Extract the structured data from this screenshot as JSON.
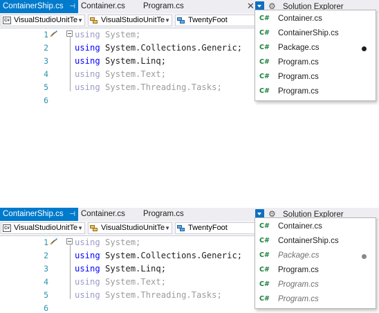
{
  "colors": {
    "accent": "#007acc",
    "keyword": "#0000ff",
    "line_number": "#2b91af",
    "csharp_icon": "#1a7f38"
  },
  "panels": [
    {
      "tabs": [
        {
          "label": "ContainerShip.cs",
          "pin": "⊣",
          "active": true
        },
        {
          "label": "Container.cs",
          "active": false
        },
        {
          "label": "Program.cs",
          "active": false
        }
      ],
      "solution_explorer_title": "Solution Explorer",
      "nav": {
        "project": "VisualStudioUnitTe",
        "namespace": "VisualStudioUnitTe",
        "member": "TwentyFoot"
      },
      "code_lines": [
        {
          "n": "1",
          "kw": "using",
          "rest": " System;",
          "dim": true
        },
        {
          "n": "2",
          "kw": "using",
          "rest": " System.Collections.Generic;",
          "dim": false
        },
        {
          "n": "3",
          "kw": "using",
          "rest": " System.Linq;",
          "dim": false
        },
        {
          "n": "4",
          "kw": "using",
          "rest": " System.Text;",
          "dim": true
        },
        {
          "n": "5",
          "kw": "using",
          "rest": " System.Threading.Tasks;",
          "dim": true
        },
        {
          "n": "6",
          "kw": "",
          "rest": "",
          "dim": false
        }
      ],
      "dropdown": [
        {
          "icon": "C#",
          "label": "Container.cs",
          "italic": false,
          "modified": false
        },
        {
          "icon": "C#",
          "label": "ContainerShip.cs",
          "italic": false,
          "modified": false
        },
        {
          "icon": "C#",
          "label": "Package.cs",
          "italic": false,
          "modified": true
        },
        {
          "icon": "C#",
          "label": "Program.cs",
          "italic": false,
          "modified": false
        },
        {
          "icon": "C#",
          "label": "Program.cs",
          "italic": false,
          "modified": false
        },
        {
          "icon": "C#",
          "label": "Program.cs",
          "italic": false,
          "modified": false
        }
      ]
    },
    {
      "tabs": [
        {
          "label": "ContainerShip.cs",
          "pin": "⊣",
          "active": true
        },
        {
          "label": "Container.cs",
          "active": false
        },
        {
          "label": "Program.cs",
          "active": false
        }
      ],
      "solution_explorer_title": "Solution Explorer",
      "nav": {
        "project": "VisualStudioUnitTe",
        "namespace": "VisualStudioUnitTe",
        "member": "TwentyFoot"
      },
      "code_lines": [
        {
          "n": "1",
          "kw": "using",
          "rest": " System;",
          "dim": true
        },
        {
          "n": "2",
          "kw": "using",
          "rest": " System.Collections.Generic;",
          "dim": false
        },
        {
          "n": "3",
          "kw": "using",
          "rest": " System.Linq;",
          "dim": false
        },
        {
          "n": "4",
          "kw": "using",
          "rest": " System.Text;",
          "dim": true
        },
        {
          "n": "5",
          "kw": "using",
          "rest": " System.Threading.Tasks;",
          "dim": true
        },
        {
          "n": "6",
          "kw": "",
          "rest": "",
          "dim": false
        }
      ],
      "dropdown": [
        {
          "icon": "C#",
          "label": "Container.cs",
          "italic": false,
          "modified": false
        },
        {
          "icon": "C#",
          "label": "ContainerShip.cs",
          "italic": false,
          "modified": false
        },
        {
          "icon": "C#",
          "label": "Package.cs",
          "italic": true,
          "modified": true
        },
        {
          "icon": "C#",
          "label": "Program.cs",
          "italic": false,
          "modified": false
        },
        {
          "icon": "C#",
          "label": "Program.cs",
          "italic": true,
          "modified": false
        },
        {
          "icon": "C#",
          "label": "Program.cs",
          "italic": true,
          "modified": false
        }
      ]
    }
  ]
}
